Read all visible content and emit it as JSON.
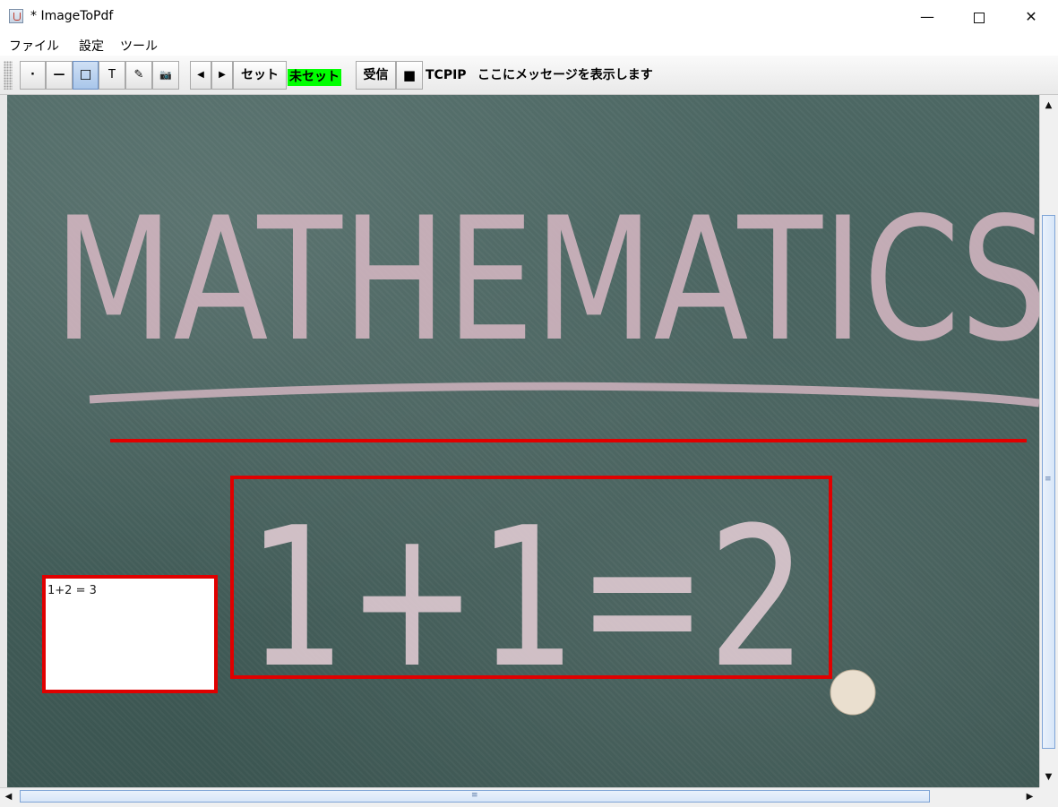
{
  "window": {
    "title": "* ImageToPdf",
    "minimize_glyph": "—",
    "close_glyph": "✕"
  },
  "menu": {
    "items": [
      "ファイル",
      "設定",
      "ツール"
    ]
  },
  "toolbar": {
    "point_glyph": "·",
    "line_glyph": "—",
    "rect_glyph": "☐",
    "text_glyph": "T",
    "pen_glyph": "✎",
    "camera_glyph": "📷",
    "prev_glyph": "◀",
    "next_glyph": "▶",
    "set_label": "セット",
    "unset_label": "未セット",
    "unset_color": "#00ff00",
    "receive_label": "受信",
    "stop_glyph": "■",
    "tcpip_label": "TCPIP",
    "message": "ここにメッセージを表示します"
  },
  "canvas": {
    "chalk_title": "MATHEMATICS",
    "chalk_equation": "1+1=2",
    "annotation_color": "#e00000",
    "text_box": "1+2 = 3"
  },
  "scrollbars": {
    "up_glyph": "▲",
    "down_glyph": "▼",
    "left_glyph": "◀",
    "right_glyph": "▶",
    "grip_glyph": "≡"
  }
}
